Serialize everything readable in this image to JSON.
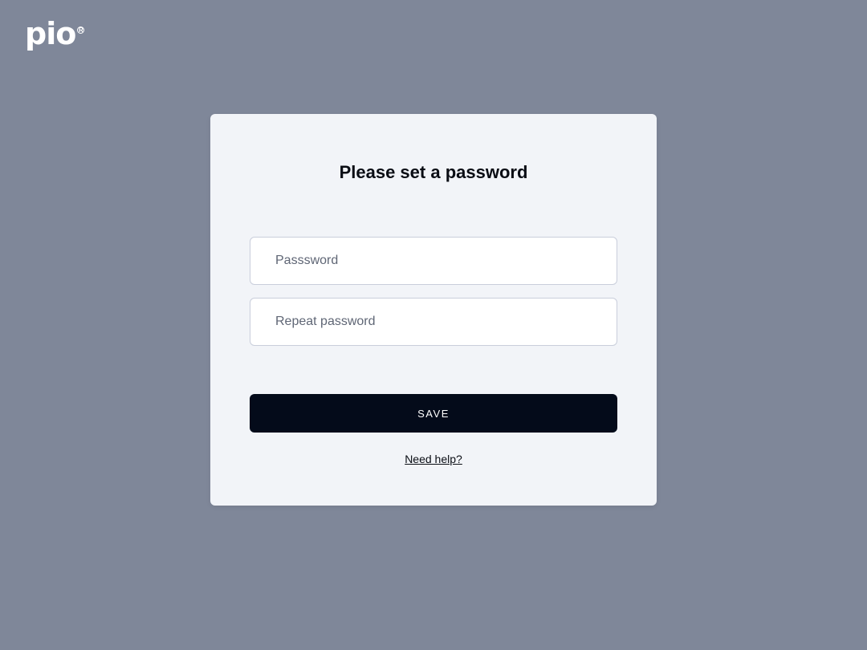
{
  "logo": {
    "text": "pio",
    "registered": "R"
  },
  "card": {
    "title": "Please set a password",
    "password_placeholder": "Passsword",
    "repeat_placeholder": "Repeat password",
    "save_label": "SAVE",
    "help_label": "Need help?"
  },
  "colors": {
    "background": "#7f8799",
    "card": "#f2f4f8",
    "button": "#040b1a"
  }
}
